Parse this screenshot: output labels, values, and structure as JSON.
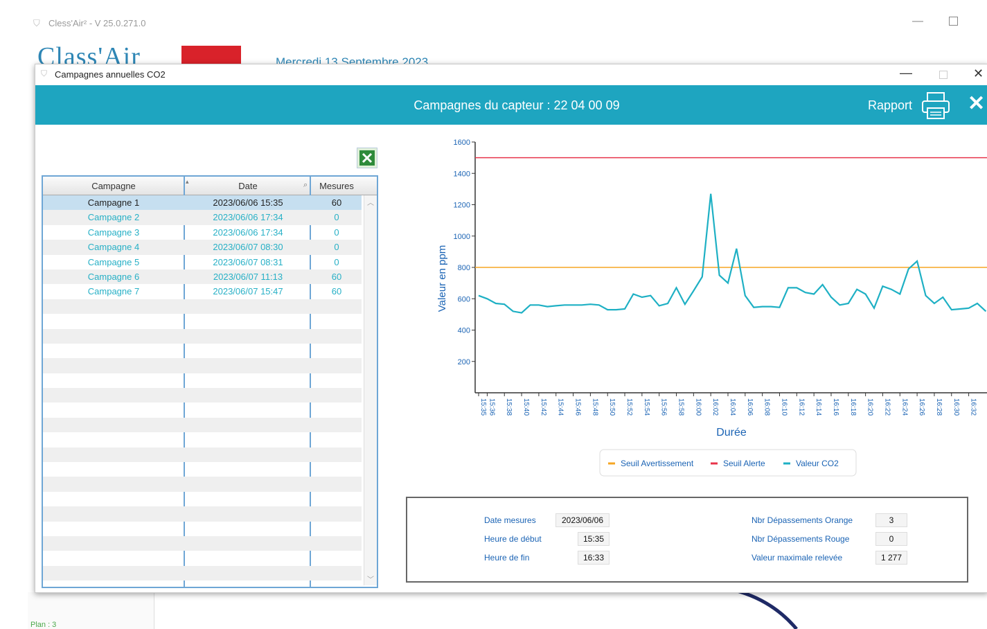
{
  "app": {
    "title": "Cless'Air² - V 25.0.271.0",
    "logo": "Class'Air",
    "date": "Mercredi 13 Septembre 2023",
    "plan": "Plan : 3"
  },
  "dialog": {
    "title": "Campagnes annuelles CO2",
    "heading": "Campagnes du capteur : 22 04 00 09",
    "report_label": "Rapport"
  },
  "grid": {
    "columns": [
      "Campagne",
      "Date",
      "Mesures"
    ],
    "rows": [
      {
        "campagne": "Campagne 1",
        "date": "2023/06/06 15:35",
        "mesures": "60"
      },
      {
        "campagne": "Campagne 2",
        "date": "2023/06/06 17:34",
        "mesures": "0"
      },
      {
        "campagne": "Campagne 3",
        "date": "2023/06/06 17:34",
        "mesures": "0"
      },
      {
        "campagne": "Campagne 4",
        "date": "2023/06/07 08:30",
        "mesures": "0"
      },
      {
        "campagne": "Campagne 5",
        "date": "2023/06/07 08:31",
        "mesures": "0"
      },
      {
        "campagne": "Campagne 6",
        "date": "2023/06/07 11:13",
        "mesures": "60"
      },
      {
        "campagne": "Campagne 7",
        "date": "2023/06/07 15:47",
        "mesures": "60"
      }
    ]
  },
  "chart_data": {
    "type": "line",
    "title": "",
    "xlabel": "Durée",
    "ylabel": "Valeur en ppm",
    "ylim": [
      0,
      1600
    ],
    "yticks": [
      200,
      400,
      600,
      800,
      1000,
      1200,
      1400,
      1600
    ],
    "x": [
      "15:35",
      "15:36",
      "15:37",
      "15:38",
      "15:39",
      "15:40",
      "15:41",
      "15:42",
      "15:43",
      "15:44",
      "15:45",
      "15:46",
      "15:47",
      "15:48",
      "15:49",
      "15:50",
      "15:51",
      "15:52",
      "15:53",
      "15:54",
      "15:55",
      "15:56",
      "15:57",
      "15:58",
      "15:59",
      "16:00",
      "16:01",
      "16:02",
      "16:03",
      "16:04",
      "16:05",
      "16:06",
      "16:07",
      "16:08",
      "16:09",
      "16:10",
      "16:11",
      "16:12",
      "16:13",
      "16:14",
      "16:15",
      "16:16",
      "16:17",
      "16:18",
      "16:19",
      "16:20",
      "16:21",
      "16:22",
      "16:23",
      "16:24",
      "16:25",
      "16:26",
      "16:27",
      "16:28",
      "16:29",
      "16:30",
      "16:31",
      "16:32",
      "16:33"
    ],
    "xtick_labels": [
      "15:35",
      "15:36",
      "15:38",
      "15:40",
      "15:42",
      "15:44",
      "15:46",
      "15:48",
      "15:50",
      "15:52",
      "15:54",
      "15:56",
      "15:58",
      "16:00",
      "16:02",
      "16:04",
      "16:06",
      "16:08",
      "16:10",
      "16:12",
      "16:14",
      "16:16",
      "16:18",
      "16:20",
      "16:22",
      "16:24",
      "16:26",
      "16:28",
      "16:30",
      "16:32"
    ],
    "series": [
      {
        "name": "Seuil Avertissement",
        "color": "#f5a623",
        "values_constant": 800
      },
      {
        "name": "Seuil Alerte",
        "color": "#e8344a",
        "values_constant": 1500
      },
      {
        "name": "Valeur CO2",
        "color": "#1eb0c4",
        "values": [
          620,
          600,
          570,
          565,
          520,
          510,
          560,
          560,
          550,
          555,
          560,
          560,
          560,
          565,
          560,
          530,
          530,
          535,
          630,
          610,
          620,
          555,
          570,
          670,
          565,
          650,
          740,
          1270,
          750,
          700,
          920,
          620,
          545,
          550,
          550,
          545,
          670,
          670,
          640,
          630,
          690,
          610,
          560,
          570,
          660,
          630,
          540,
          680,
          660,
          630,
          790,
          840,
          620,
          570,
          610,
          530,
          535,
          540,
          570,
          520
        ]
      }
    ],
    "legend_position": "bottom"
  },
  "info": {
    "date_label": "Date mesures",
    "date_value": "2023/06/06",
    "start_label": "Heure de début",
    "start_value": "15:35",
    "end_label": "Heure de  fin",
    "end_value": "16:33",
    "orange_label": "Nbr Dépassements Orange",
    "orange_value": "3",
    "red_label": "Nbr Dépassements Rouge",
    "red_value": "0",
    "max_label": "Valeur maximale relevée",
    "max_value": "1 277"
  }
}
